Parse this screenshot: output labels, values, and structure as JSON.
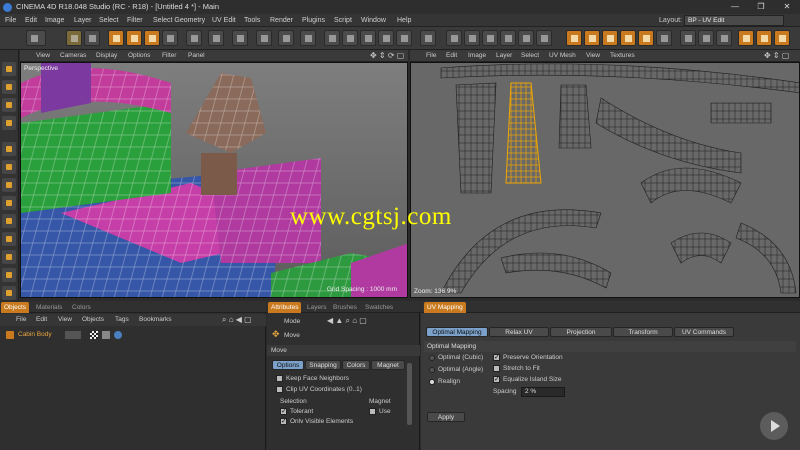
{
  "window": {
    "title": "CINEMA 4D R18.048 Studio (RC - R18) - [Untitled 4 *] - Main",
    "controls": [
      "minimize-icon",
      "maximize-icon",
      "close-icon"
    ]
  },
  "menubar": {
    "items": [
      "File",
      "Edit",
      "Image",
      "Layer",
      "Select",
      "Filter",
      "Select Geometry",
      "UV Edit",
      "Tools",
      "Render",
      "Plugins",
      "Script",
      "Window",
      "Help"
    ],
    "layout_label": "Layout:",
    "layout_value": "BP - UV Edit"
  },
  "viewport": {
    "menu": [
      "View",
      "Cameras",
      "Display",
      "Options",
      "Filter",
      "Panel"
    ],
    "label": "Perspective",
    "grid_spacing": "Grid Spacing : 1000 mm"
  },
  "uv_editor": {
    "menu": [
      "File",
      "Edit",
      "Image",
      "Layer",
      "Select",
      "UV Mesh",
      "View",
      "Textures"
    ],
    "zoom": "Zoom: 136.9%"
  },
  "watermark": "www.cgtsj.com",
  "objects_panel": {
    "tabs": [
      "Objects",
      "Materials",
      "Colors"
    ],
    "active_tab": "Objects",
    "menu": [
      "File",
      "Edit",
      "View",
      "Objects",
      "Tags",
      "Bookmarks"
    ],
    "object_name": "Cabin Body"
  },
  "attributes_panel": {
    "tabs": [
      "Attributes",
      "Layers",
      "Brushes",
      "Swatches"
    ],
    "mode_label": "Mode",
    "tool_name": "Move",
    "section_title": "Move",
    "subtabs": [
      "Options",
      "Snapping",
      "Colors",
      "Magnet"
    ],
    "options": [
      {
        "label": "Keep Face Neighbors",
        "checked": false
      },
      {
        "label": "Clip UV Coordinates (0..1)",
        "checked": false
      }
    ],
    "selection_label": "Selection",
    "magnet_label": "Magnet",
    "tolerant_label": "Tolerant",
    "only_visible_label": "Only Visible Elements",
    "use_label": "Use"
  },
  "uv_panel": {
    "tabs": [
      "UV Mapping"
    ],
    "subtabs": [
      "Optimal Mapping",
      "Relax UV",
      "Projection",
      "Transform",
      "UV Commands"
    ],
    "active_subtab": "Optimal Mapping",
    "section_title": "Optimal Mapping",
    "radios": [
      {
        "label": "Optimal (Cubic)",
        "selected": false
      },
      {
        "label": "Optimal (Angle)",
        "selected": false
      },
      {
        "label": "Realign",
        "selected": true
      }
    ],
    "checks": [
      {
        "label": "Preserve Orientation",
        "checked": true
      },
      {
        "label": "Stretch to Fit",
        "checked": false
      },
      {
        "label": "Equalize Island Size",
        "checked": true
      }
    ],
    "spacing_label": "Spacing",
    "spacing_value": "2 %",
    "apply_label": "Apply"
  },
  "colors": {
    "accent": "#c97a1e",
    "active_tab": "#7ba0c9",
    "selected_uv": "#f0a800",
    "watermark": "#ffff00"
  }
}
